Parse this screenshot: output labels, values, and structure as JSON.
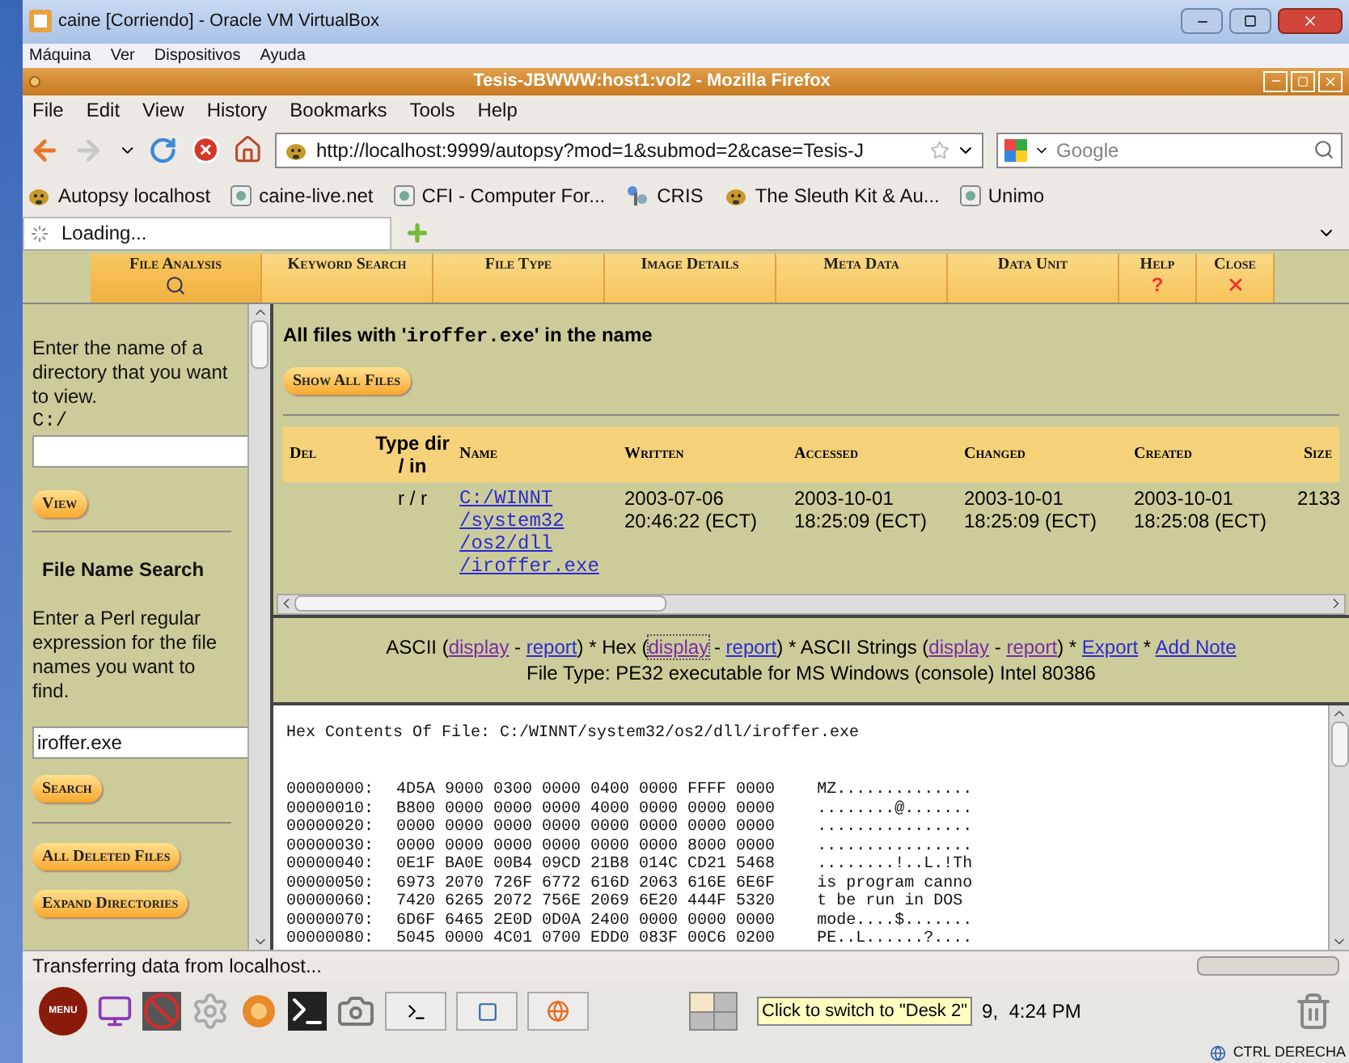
{
  "vbox": {
    "title": "caine [Corriendo] - Oracle VM VirtualBox",
    "menu": [
      "Máquina",
      "Ver",
      "Dispositivos",
      "Ayuda"
    ]
  },
  "firefox": {
    "title": "Tesis-JBWWW:host1:vol2 - Mozilla Firefox",
    "menu": [
      "File",
      "Edit",
      "View",
      "History",
      "Bookmarks",
      "Tools",
      "Help"
    ],
    "url": "http://localhost:9999/autopsy?mod=1&submod=2&case=Tesis-J",
    "search": {
      "placeholder": "Google"
    },
    "bookmarks": [
      {
        "label": "Autopsy localhost",
        "kind": "dog"
      },
      {
        "label": "caine-live.net",
        "kind": "page"
      },
      {
        "label": "CFI - Computer For...",
        "kind": "page"
      },
      {
        "label": "CRIS",
        "kind": "cris"
      },
      {
        "label": "The Sleuth Kit & Au...",
        "kind": "dog"
      },
      {
        "label": "Unimo",
        "kind": "page"
      }
    ],
    "tab": {
      "label": "Loading..."
    }
  },
  "toolbar": [
    {
      "label": "File Analysis",
      "kind": "search",
      "selected": true
    },
    {
      "label": "Keyword Search",
      "kind": "none",
      "selected": false
    },
    {
      "label": "File Type",
      "kind": "none",
      "selected": false
    },
    {
      "label": "Image Details",
      "kind": "none",
      "selected": false
    },
    {
      "label": "Meta Data",
      "kind": "none",
      "selected": false
    },
    {
      "label": "Data Unit",
      "kind": "none",
      "selected": false
    },
    {
      "label": "Help",
      "kind": "help",
      "glyph": "?",
      "selected": false
    },
    {
      "label": "Close",
      "kind": "close",
      "selected": false
    }
  ],
  "sidebar": {
    "dir_prompt": "Enter the name of a directory that you want to view.",
    "dir_prefix": "C:/",
    "view_button": "View",
    "search_title": "File Name Search",
    "search_prompt": "Enter a Perl regular expression for the file names you want to find.",
    "search_value": "iroffer.exe",
    "search_button": "Search",
    "buttons": [
      "All Deleted Files",
      "Expand Directories"
    ]
  },
  "results": {
    "heading_pre": "All files with '",
    "heading_term": "iroffer.exe",
    "heading_post": "' in the name",
    "show_all": "Show All Files",
    "columns": [
      "Del",
      "Type dir / in",
      "Name",
      "Written",
      "Accessed",
      "Changed",
      "Created",
      "Size"
    ],
    "rows": [
      {
        "del": "",
        "type": "r / r",
        "name": [
          "C:/WINNT",
          "/system32",
          "/os2/dll",
          "/iroffer.exe"
        ],
        "written": [
          "2003-07-06",
          "20:46:22 (ECT)"
        ],
        "accessed": [
          "2003-10-01",
          "18:25:09 (ECT)"
        ],
        "changed": [
          "2003-10-01",
          "18:25:09 (ECT)"
        ],
        "created": [
          "2003-10-01",
          "18:25:08 (ECT)"
        ],
        "size": "2133"
      }
    ]
  },
  "views": {
    "items": [
      {
        "kind": "text",
        "text": "ASCII ("
      },
      {
        "kind": "link",
        "text": "display",
        "visited": true
      },
      {
        "kind": "text",
        "text": " - "
      },
      {
        "kind": "link",
        "text": "report",
        "visited": false
      },
      {
        "kind": "text",
        "text": ") * Hex ("
      },
      {
        "kind": "link",
        "text": "display",
        "visited": true,
        "focused": true
      },
      {
        "kind": "text",
        "text": " - "
      },
      {
        "kind": "link",
        "text": "report",
        "visited": false
      },
      {
        "kind": "text",
        "text": ") * ASCII Strings ("
      },
      {
        "kind": "link",
        "text": "display",
        "visited": true
      },
      {
        "kind": "text",
        "text": " - "
      },
      {
        "kind": "link",
        "text": "report",
        "visited": true
      },
      {
        "kind": "text",
        "text": ") * "
      },
      {
        "kind": "link",
        "text": "Export",
        "visited": false
      },
      {
        "kind": "text",
        "text": " * "
      },
      {
        "kind": "link",
        "text": "Add Note",
        "visited": false
      }
    ],
    "file_type": "File Type: PE32 executable for MS Windows (console) Intel 80386"
  },
  "hex": {
    "title": "Hex Contents Of File: C:/WINNT/system32/os2/dll/iroffer.exe",
    "rows": [
      {
        "offset": "00000000:",
        "hex": "4D5A 9000 0300 0000 0400 0000 FFFF 0000",
        "ascii": "MZ.............."
      },
      {
        "offset": "00000010:",
        "hex": "B800 0000 0000 0000 4000 0000 0000 0000",
        "ascii": "........@......."
      },
      {
        "offset": "00000020:",
        "hex": "0000 0000 0000 0000 0000 0000 0000 0000",
        "ascii": "................"
      },
      {
        "offset": "00000030:",
        "hex": "0000 0000 0000 0000 0000 0000 8000 0000",
        "ascii": "................"
      },
      {
        "offset": "00000040:",
        "hex": "0E1F BA0E 00B4 09CD 21B8 014C CD21 5468",
        "ascii": "........!..L.!Th"
      },
      {
        "offset": "00000050:",
        "hex": "6973 2070 726F 6772 616D 2063 616E 6E6F",
        "ascii": "is program canno"
      },
      {
        "offset": "00000060:",
        "hex": "7420 6265 2072 756E 2069 6E20 444F 5320",
        "ascii": "t be run in DOS "
      },
      {
        "offset": "00000070:",
        "hex": "6D6F 6465 2E0D 0D0A 2400 0000 0000 0000",
        "ascii": "mode....$......."
      },
      {
        "offset": "00000080:",
        "hex": "5045 0000 4C01 0700 EDD0 083F 00C6 0200",
        "ascii": "PE..L......?...."
      }
    ]
  },
  "status": "Transferring data from localhost...",
  "taskbar": {
    "menu_label": "MENU",
    "clock": "9,  4:24 PM",
    "tooltip": "Click to switch to \"Desk 2\"",
    "host_key": "CTRL DERECHA"
  }
}
